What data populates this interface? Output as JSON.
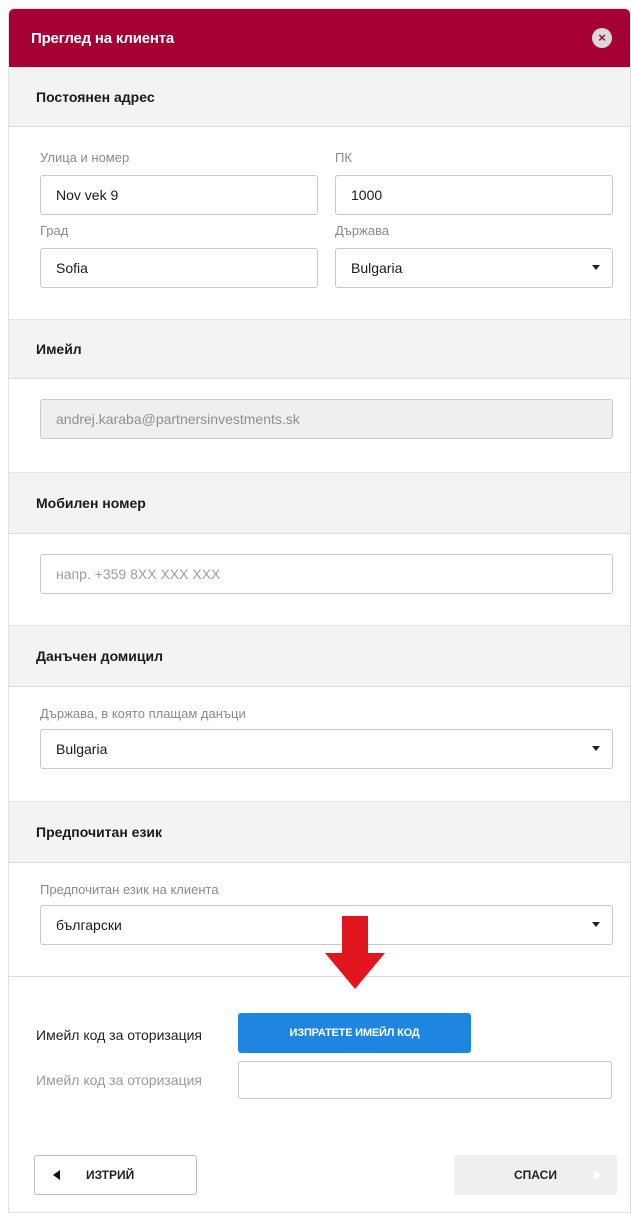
{
  "modal": {
    "title": "Преглед на клиента",
    "close_icon": "close-icon"
  },
  "address": {
    "heading": "Постоянен адрес",
    "street_label": "Улица и номер",
    "street_value": "Nov vek 9",
    "postcode_label": "ПК",
    "postcode_value": "1000",
    "city_label": "Град",
    "city_value": "Sofia",
    "country_label": "Държава",
    "country_value": "Bulgaria"
  },
  "email": {
    "heading": "Имейл",
    "value": "andrej.karaba@partnersinvestments.sk"
  },
  "mobile": {
    "heading": "Мобилен номер",
    "placeholder": "напр. +359 8XX XXX XXX"
  },
  "tax": {
    "heading": "Данъчен домицил",
    "country_label": "Държава, в която плащам данъци",
    "country_value": "Bulgaria"
  },
  "language": {
    "heading": "Предпочитан език",
    "label": "Предпочитан език на клиента",
    "value": "български"
  },
  "auth": {
    "label": "Имейл код за оторизация",
    "send_button": "ИЗПРАТЕТЕ ИМЕЙЛ КОД",
    "code_label": "Имейл код за оторизация",
    "code_value": "",
    "annotation_arrow_color": "#e0151e"
  },
  "footer": {
    "delete_label": "ИЗТРИЙ",
    "save_label": "СПАСИ"
  },
  "colors": {
    "brand": "#a50034",
    "accent": "#1e86e0"
  }
}
